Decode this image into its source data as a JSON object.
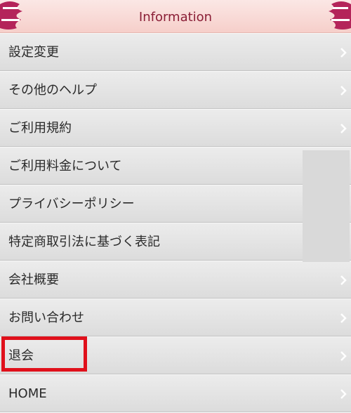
{
  "header": {
    "title": "Information"
  },
  "menu": {
    "items": [
      {
        "label": "設定変更"
      },
      {
        "label": "その他のヘルプ"
      },
      {
        "label": "ご利用規約"
      },
      {
        "label": "ご利用料金について"
      },
      {
        "label": "プライバシーポリシー"
      },
      {
        "label": "特定商取引法に基づく表記"
      },
      {
        "label": "会社概要"
      },
      {
        "label": "お問い合わせ"
      },
      {
        "label": "退会"
      },
      {
        "label": "HOME"
      }
    ]
  },
  "colors": {
    "header_title": "#8a1e36",
    "header_bg": "#f6cfca",
    "deco": "#b4245a",
    "highlight": "#e0101b"
  }
}
